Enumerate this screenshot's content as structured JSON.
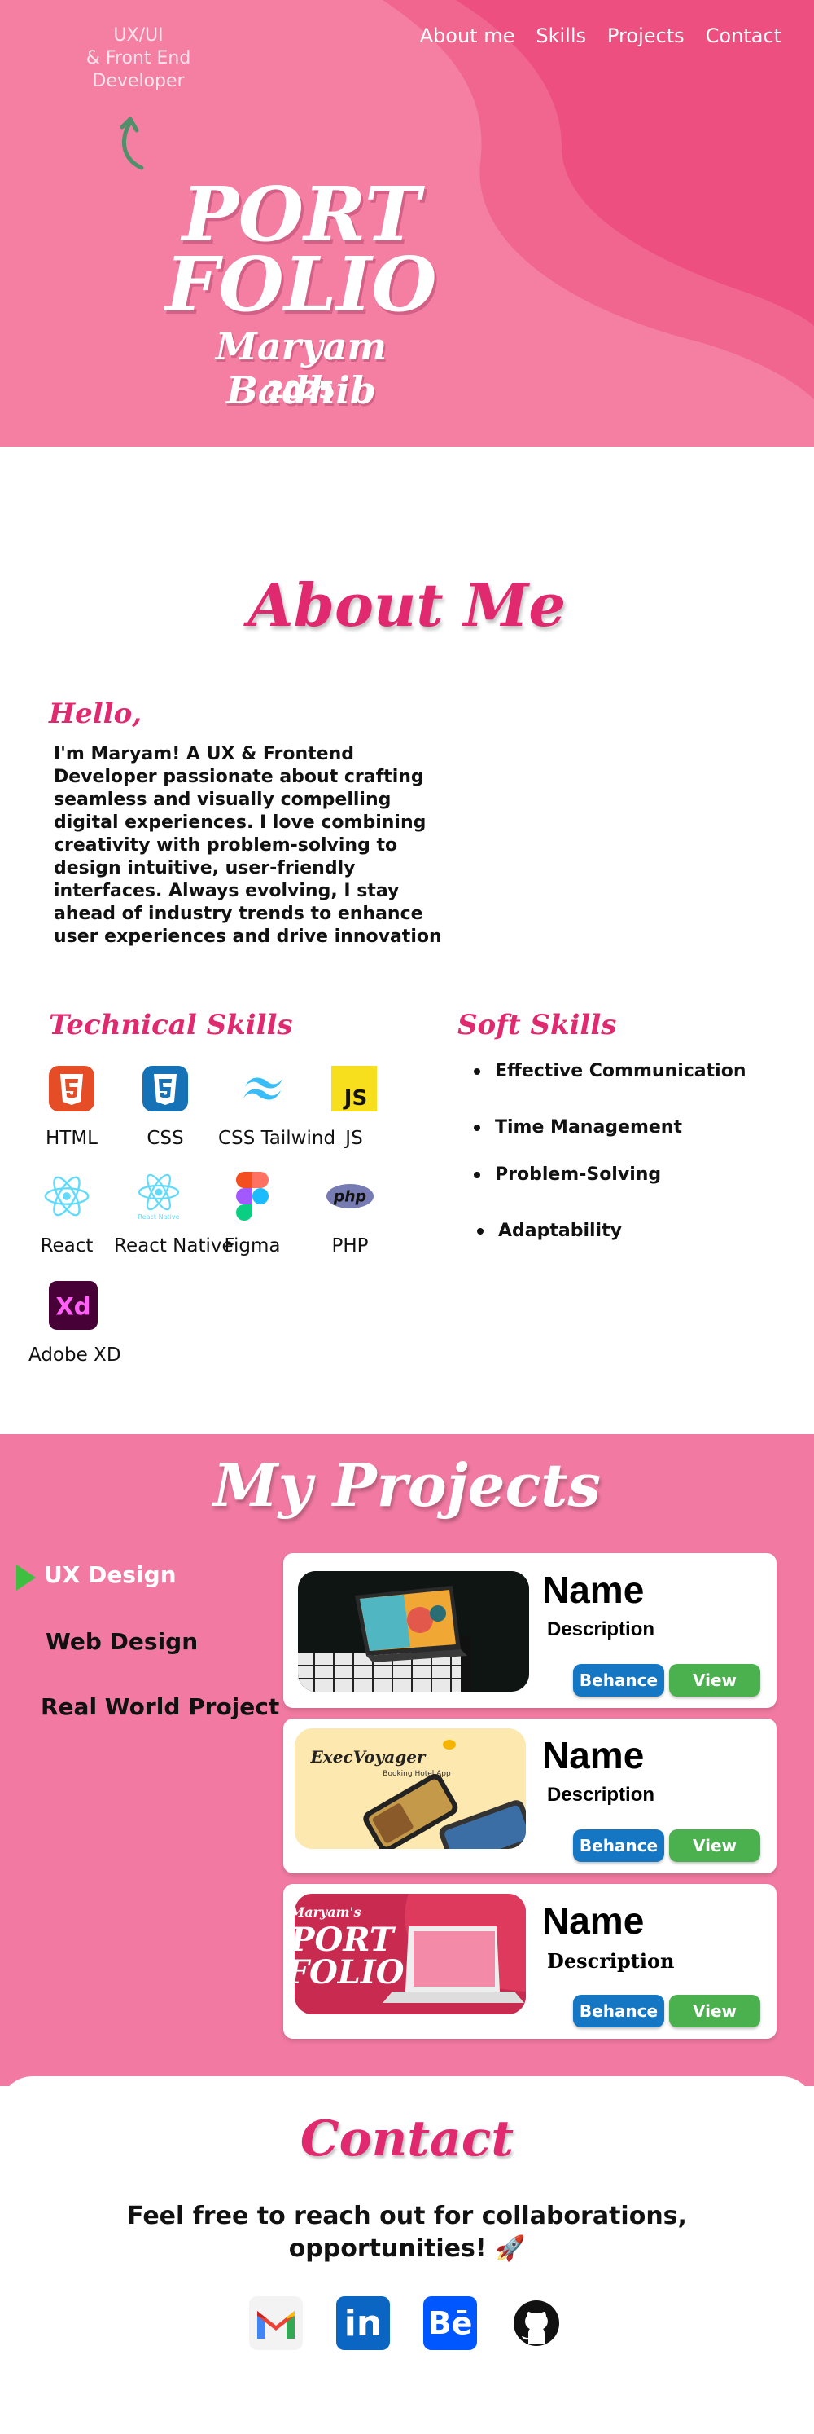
{
  "nav": {
    "items": [
      "About me",
      "Skills",
      "Projects",
      "Contact"
    ]
  },
  "hero": {
    "role_lines": [
      "UX/UI",
      "& Front End",
      "Developer"
    ],
    "title_lines": [
      "PORT",
      "FOLIO"
    ],
    "name": "Maryam Badhib",
    "year": "2025"
  },
  "about": {
    "title": "About Me",
    "greeting": "Hello,",
    "intro": "I'm Maryam! A UX & Frontend Developer passionate about crafting seamless and visually compelling digital experiences. I love combining creativity with problem-solving to design intuitive, user-friendly interfaces. Always evolving, I stay ahead of industry trends to enhance user experiences and drive innovation"
  },
  "skills": {
    "technical_title": "Technical Skills",
    "technical": [
      {
        "label": "HTML",
        "icon": "html5-icon"
      },
      {
        "label": "CSS",
        "icon": "css3-icon"
      },
      {
        "label": "CSS Tailwind",
        "icon": "tailwind-icon"
      },
      {
        "label": "JS",
        "icon": "javascript-icon"
      },
      {
        "label": "React",
        "icon": "react-icon"
      },
      {
        "label": "React Native",
        "icon": "react-native-icon",
        "icon_caption": "React Native"
      },
      {
        "label": "Figma",
        "icon": "figma-icon"
      },
      {
        "label": "PHP",
        "icon": "php-icon",
        "icon_text": "php"
      },
      {
        "label": "Adobe XD",
        "icon": "adobe-xd-icon",
        "icon_text": "Xd"
      }
    ],
    "soft_title": "Soft Skills",
    "soft": [
      "Effective Communication",
      "Time Management",
      "Problem-Solving",
      "Adaptability"
    ]
  },
  "projects": {
    "title": "My Projects",
    "tabs": [
      "UX Design",
      "Web Design",
      "Real World Project"
    ],
    "active_tab": "UX Design",
    "cards": [
      {
        "name": "Name",
        "description": "Description",
        "behance_label": "Behance",
        "view_label": "View"
      },
      {
        "name": "Name",
        "description": "Description",
        "behance_label": "Behance",
        "view_label": "View",
        "thumb_title": "ExecVoyager",
        "thumb_subtitle": "Booking Hotel App"
      },
      {
        "name": "Name",
        "description": "Description",
        "behance_label": "Behance",
        "view_label": "View",
        "thumb_lines": [
          "Maryam's",
          "PORT",
          "FOLIO"
        ]
      }
    ]
  },
  "contact": {
    "title": "Contact",
    "message": "Feel free to reach out for collaborations, opportunities! 🚀",
    "links": [
      {
        "icon": "gmail-icon"
      },
      {
        "icon": "linkedin-icon",
        "text": "in"
      },
      {
        "icon": "behance-icon",
        "text": "Bē"
      },
      {
        "icon": "github-icon"
      }
    ]
  },
  "colors": {
    "hero_bg": "#f47fa3",
    "accent_pink": "#e0296e",
    "projects_bg": "#f27aa2",
    "behance_blue": "#1577c3",
    "view_green": "#4bb14f"
  }
}
